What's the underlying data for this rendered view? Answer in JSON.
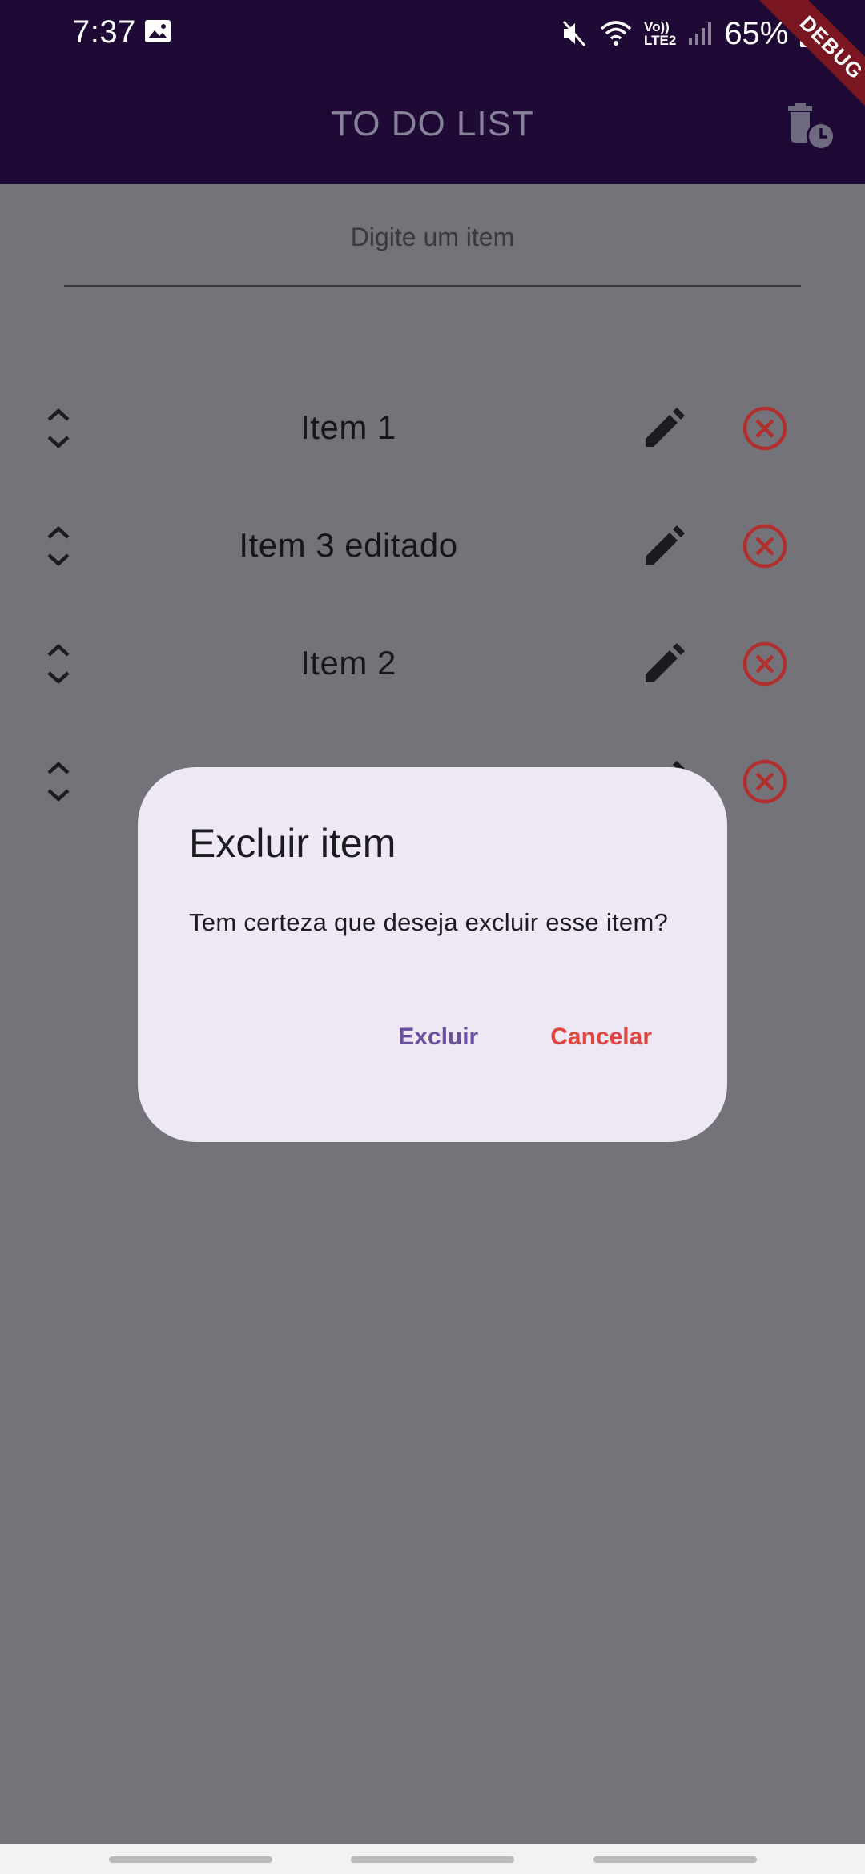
{
  "status_bar": {
    "time": "7:37",
    "battery": "65%",
    "network_badge_top": "Vo))",
    "network_badge_bottom": "LTE2",
    "icons": [
      "gallery-icon",
      "mute-icon",
      "wifi-icon",
      "volte-icon",
      "signal-icon",
      "battery-icon"
    ]
  },
  "app_bar": {
    "title": "TO DO LIST",
    "action_icon": "delete-history-icon",
    "debug_label": "DEBUG",
    "background_color": "#1e0a34"
  },
  "input": {
    "placeholder": "Digite um item",
    "value": ""
  },
  "list": {
    "items": [
      {
        "label": "Item 1"
      },
      {
        "label": "Item 3 editado"
      },
      {
        "label": "Item 2"
      },
      {
        "label": ""
      }
    ],
    "edit_icon": "pencil-icon",
    "delete_icon": "circle-x-icon",
    "delete_color": "#b03030"
  },
  "dialog": {
    "title": "Excluir item",
    "message": "Tem certeza que deseja excluir esse item?",
    "confirm_label": "Excluir",
    "cancel_label": "Cancelar",
    "confirm_color": "#6a4fa0",
    "cancel_color": "#e0463e"
  }
}
